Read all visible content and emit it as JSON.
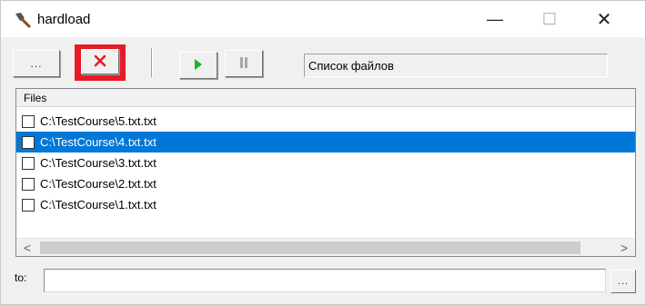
{
  "window": {
    "title": "hardload",
    "app_icon": "shovel-icon",
    "controls": {
      "minimize": "—",
      "maximize": "☐",
      "close": "✕"
    }
  },
  "toolbar": {
    "browse_label": "...",
    "delete_icon": "close-icon",
    "delete_color": "#e81a26",
    "play_icon": "play-icon",
    "play_color": "#1db31d",
    "pause_icon": "pause-icon",
    "status_text": "Список файлов"
  },
  "file_list": {
    "column_header": "Files",
    "selected_color": "#0078d7",
    "items": [
      {
        "path": "C:\\TestCourse\\5.txt.txt",
        "checked": false,
        "selected": false
      },
      {
        "path": "C:\\TestCourse\\4.txt.txt",
        "checked": false,
        "selected": true
      },
      {
        "path": "C:\\TestCourse\\3.txt.txt",
        "checked": false,
        "selected": false
      },
      {
        "path": "C:\\TestCourse\\2.txt.txt",
        "checked": false,
        "selected": false
      },
      {
        "path": "C:\\TestCourse\\1.txt.txt",
        "checked": false,
        "selected": false
      }
    ],
    "scroll_left": "<",
    "scroll_right": ">"
  },
  "destination": {
    "label": "to:",
    "value": "",
    "browse_label": "..."
  }
}
